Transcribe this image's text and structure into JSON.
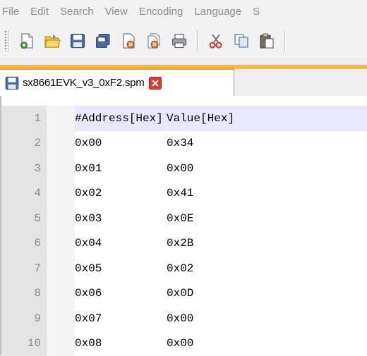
{
  "menubar": {
    "items": [
      "File",
      "Edit",
      "Search",
      "View",
      "Encoding",
      "Language",
      "S"
    ]
  },
  "toolbar": {
    "icons": [
      "new-file-icon",
      "open-file-icon",
      "save-icon",
      "save-all-icon",
      "close-file-icon",
      "close-all-icon",
      "print-icon",
      "cut-icon",
      "copy-icon",
      "paste-icon"
    ]
  },
  "tab": {
    "title": "sx8661EVK_v3_0xF2.spm"
  },
  "editor": {
    "lines": [
      {
        "number": "1",
        "col1": "#Address[Hex]",
        "col2": "Value[Hex]"
      },
      {
        "number": "2",
        "col1": "0x00",
        "col2": "0x34"
      },
      {
        "number": "3",
        "col1": "0x01",
        "col2": "0x00"
      },
      {
        "number": "4",
        "col1": "0x02",
        "col2": "0x41"
      },
      {
        "number": "5",
        "col1": "0x03",
        "col2": "0x0E"
      },
      {
        "number": "6",
        "col1": "0x04",
        "col2": "0x2B"
      },
      {
        "number": "7",
        "col1": "0x05",
        "col2": "0x02"
      },
      {
        "number": "8",
        "col1": "0x06",
        "col2": "0x0D"
      },
      {
        "number": "9",
        "col1": "0x07",
        "col2": "0x00"
      },
      {
        "number": "10",
        "col1": "0x08",
        "col2": "0x00"
      }
    ]
  },
  "colors": {
    "tab_accent": "#f4a52c",
    "current_line": "#e8e8ff",
    "gutter_bg": "#e4e4e4"
  }
}
